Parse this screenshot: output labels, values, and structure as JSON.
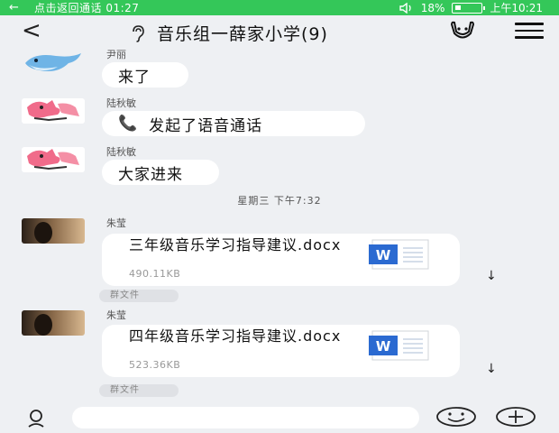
{
  "status_bar": {
    "back_arrow": "←",
    "call_text": "点击返回通话 01:27",
    "volume_icon": "volume-icon",
    "battery": "18%",
    "time": "上午10:21",
    "bar_color": "#34c759"
  },
  "header": {
    "back": "<",
    "title": "音乐组一薛家小学(9)",
    "mute_icon": "ear-mute-icon",
    "group_icon": "group-icon",
    "menu_icon": "menu-icon"
  },
  "messages": [
    {
      "sender": "尹丽",
      "text": "来了",
      "avatar": "dolphin-avatar"
    },
    {
      "sender": "陆秋敏",
      "text": "发起了语音通话",
      "icon": "phone-icon",
      "phone_glyph": "📞",
      "avatar": "cartoon-avatar"
    },
    {
      "sender": "陆秋敏",
      "text": "大家进来",
      "avatar": "cartoon-avatar"
    }
  ],
  "time_separator": "星期三  下午7:32",
  "files": [
    {
      "sender": "朱莹",
      "name": "三年级音乐学习指导建议.docx",
      "size": "490.11KB",
      "tag": "群文件",
      "download": "↓"
    },
    {
      "sender": "朱莹",
      "name": "四年级音乐学习指导建议.docx",
      "size": "523.36KB",
      "tag": "群文件",
      "download": "↓"
    }
  ],
  "word_icon_letter": "W",
  "word_color": "#2b6ad1",
  "bottom_bar": {
    "voice_icon": "voice-icon",
    "input_placeholder": "",
    "emoji_icon": "emoji-icon",
    "plus_icon": "plus-icon"
  }
}
